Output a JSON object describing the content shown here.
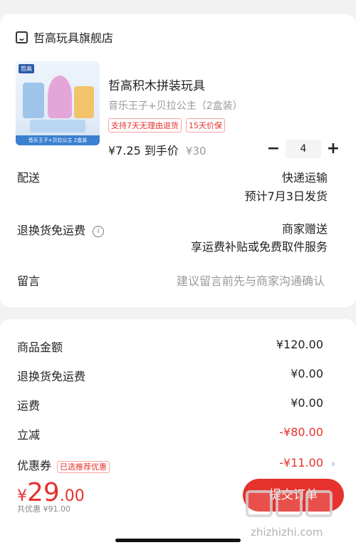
{
  "store": {
    "name": "哲高玩具旗舰店",
    "icon": "store-icon"
  },
  "product": {
    "name": "哲高积木拼装玩具",
    "spec": "音乐王子+贝拉公主（2盒装）",
    "tags": [
      "支持7天无理由退货",
      "15天价保"
    ],
    "price_final": "¥7.25 到手价",
    "price_original": "¥30",
    "quantity": "4",
    "thumb_brand": "哲高",
    "thumb_caption": "音乐王子+贝拉公主 2盒装"
  },
  "stepper": {
    "minus": "−",
    "plus": "+"
  },
  "delivery": {
    "label": "配送",
    "method": "快递运输",
    "eta": "预计7月3日发货"
  },
  "return_shipping": {
    "label": "退换货免运费",
    "value": "商家赠送",
    "detail": "享运费补贴或免费取件服务"
  },
  "message": {
    "label": "留言",
    "placeholder": "建议留言前先与商家沟通确认"
  },
  "fees": {
    "goods_label": "商品金额",
    "goods_value": "¥120.00",
    "return_label": "退换货免运费",
    "return_value": "¥0.00",
    "shipping_label": "运费",
    "shipping_value": "¥0.00",
    "discount_label": "立减",
    "discount_value": "-¥80.00",
    "coupon_label": "优惠券",
    "coupon_tag": "已选推荐优惠",
    "coupon_value": "-¥11.00"
  },
  "footer": {
    "currency": "¥",
    "total_int": "29",
    "total_dec": ".00",
    "saved": "共优惠 ¥91.00",
    "submit": "提交订单"
  },
  "watermark": {
    "text": "zhizhizhi.com"
  },
  "colors": {
    "accent": "#e5322d"
  }
}
